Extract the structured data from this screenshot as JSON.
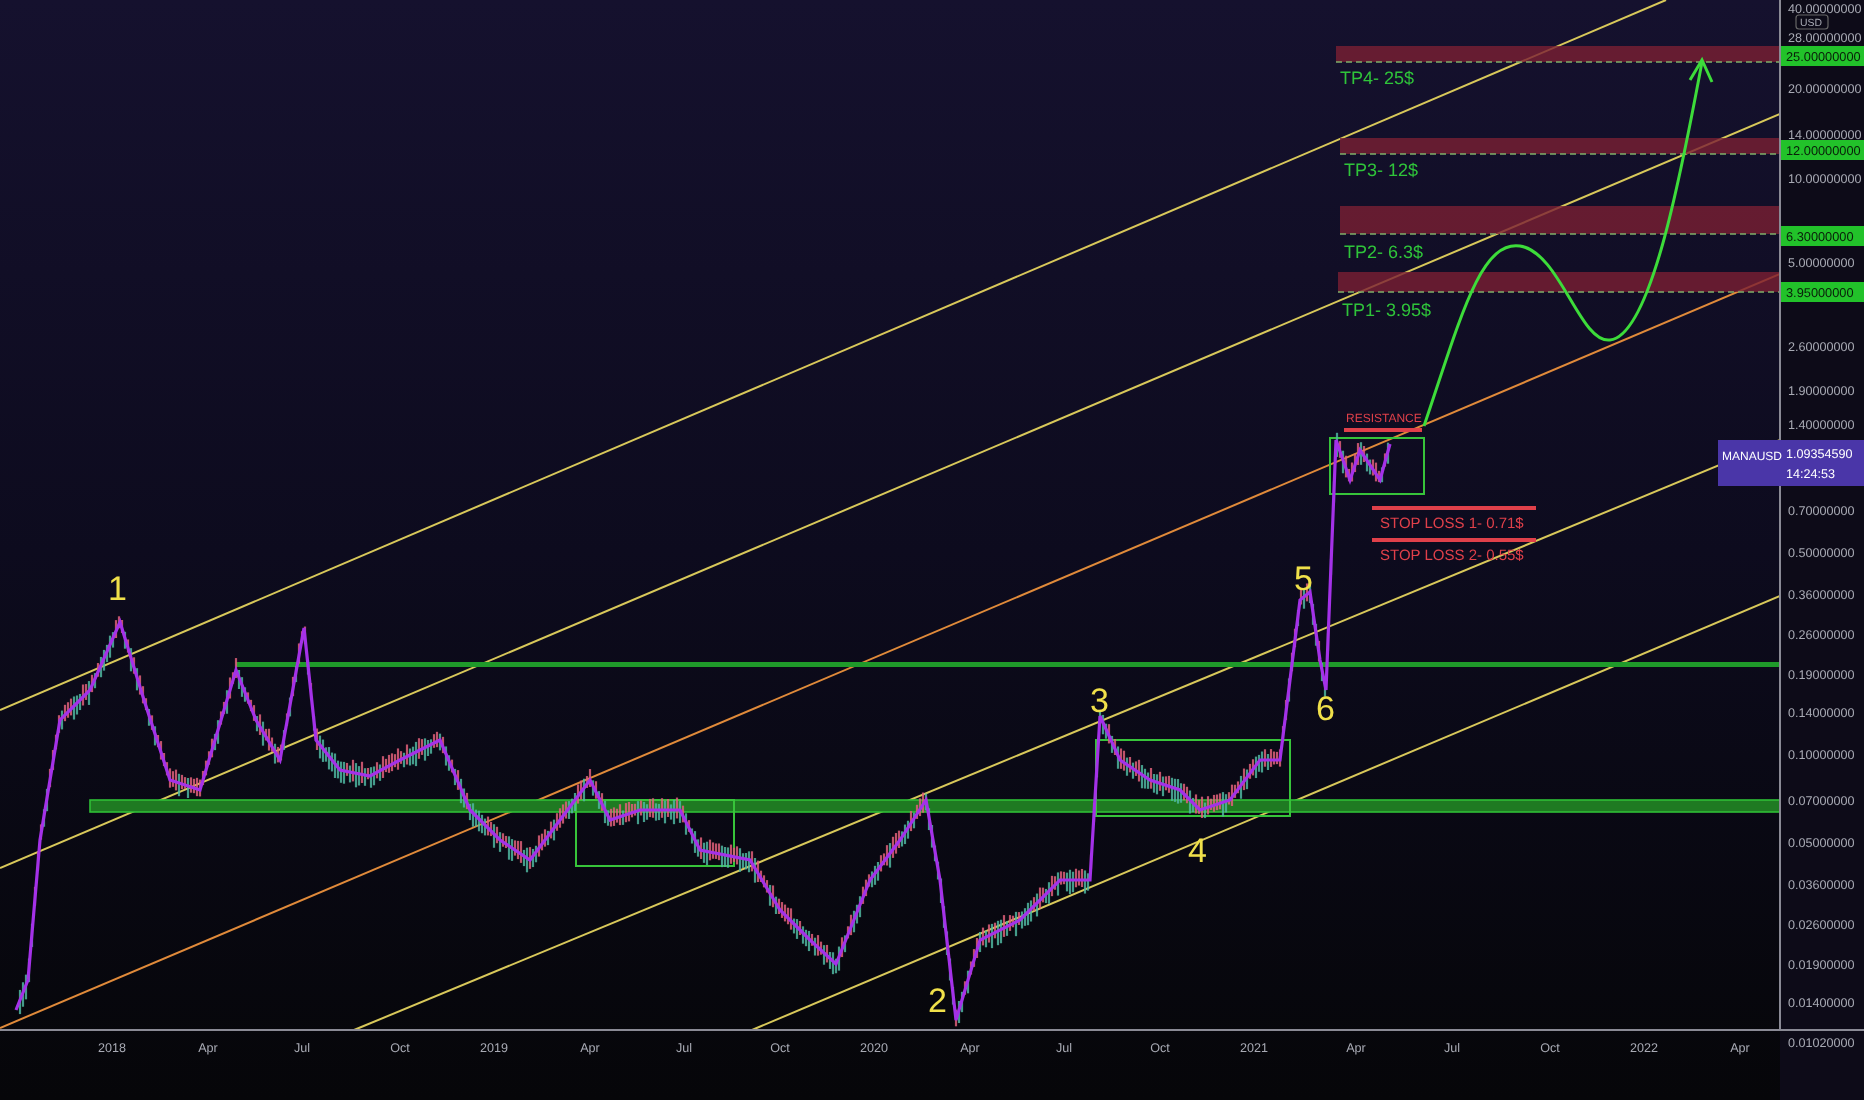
{
  "chart": {
    "currency": "USD",
    "price_ticks": [
      "40.00000000",
      "28.00000000",
      "20.00000000",
      "14.00000000",
      "10.00000000",
      "5.00000000",
      "2.60000000",
      "1.90000000",
      "1.40000000",
      "0.70000000",
      "0.50000000",
      "0.36000000",
      "0.26000000",
      "0.19000000",
      "0.14000000",
      "0.10000000",
      "0.07000000",
      "0.05000000",
      "0.03600000",
      "0.02600000",
      "0.01900000",
      "0.01400000",
      "0.01020000"
    ],
    "time_ticks": [
      "2018",
      "Apr",
      "Jul",
      "Oct",
      "2019",
      "Apr",
      "Jul",
      "Oct",
      "2020",
      "Apr",
      "Jul",
      "Oct",
      "2021",
      "Apr",
      "Jul",
      "Oct",
      "2022",
      "Apr"
    ],
    "targets": [
      {
        "label": "TP4- 25$",
        "price_tag": "25.00000000"
      },
      {
        "label": "TP3- 12$",
        "price_tag": "12.00000000"
      },
      {
        "label": "TP2- 6.3$",
        "price_tag": "6.30000000"
      },
      {
        "label": "TP1- 3.95$",
        "price_tag": "3.95000000"
      }
    ],
    "resistance": "RESISTANCE",
    "stop_losses": [
      "STOP LOSS 1- 0.71$",
      "STOP LOSS 2- 0.55$"
    ],
    "wave_labels": [
      "1",
      "2",
      "3",
      "4",
      "5",
      "6"
    ],
    "symbol_tag": {
      "symbol": "MANAUSD",
      "price": "1.09354590",
      "countdown": "14:24:53"
    }
  }
}
